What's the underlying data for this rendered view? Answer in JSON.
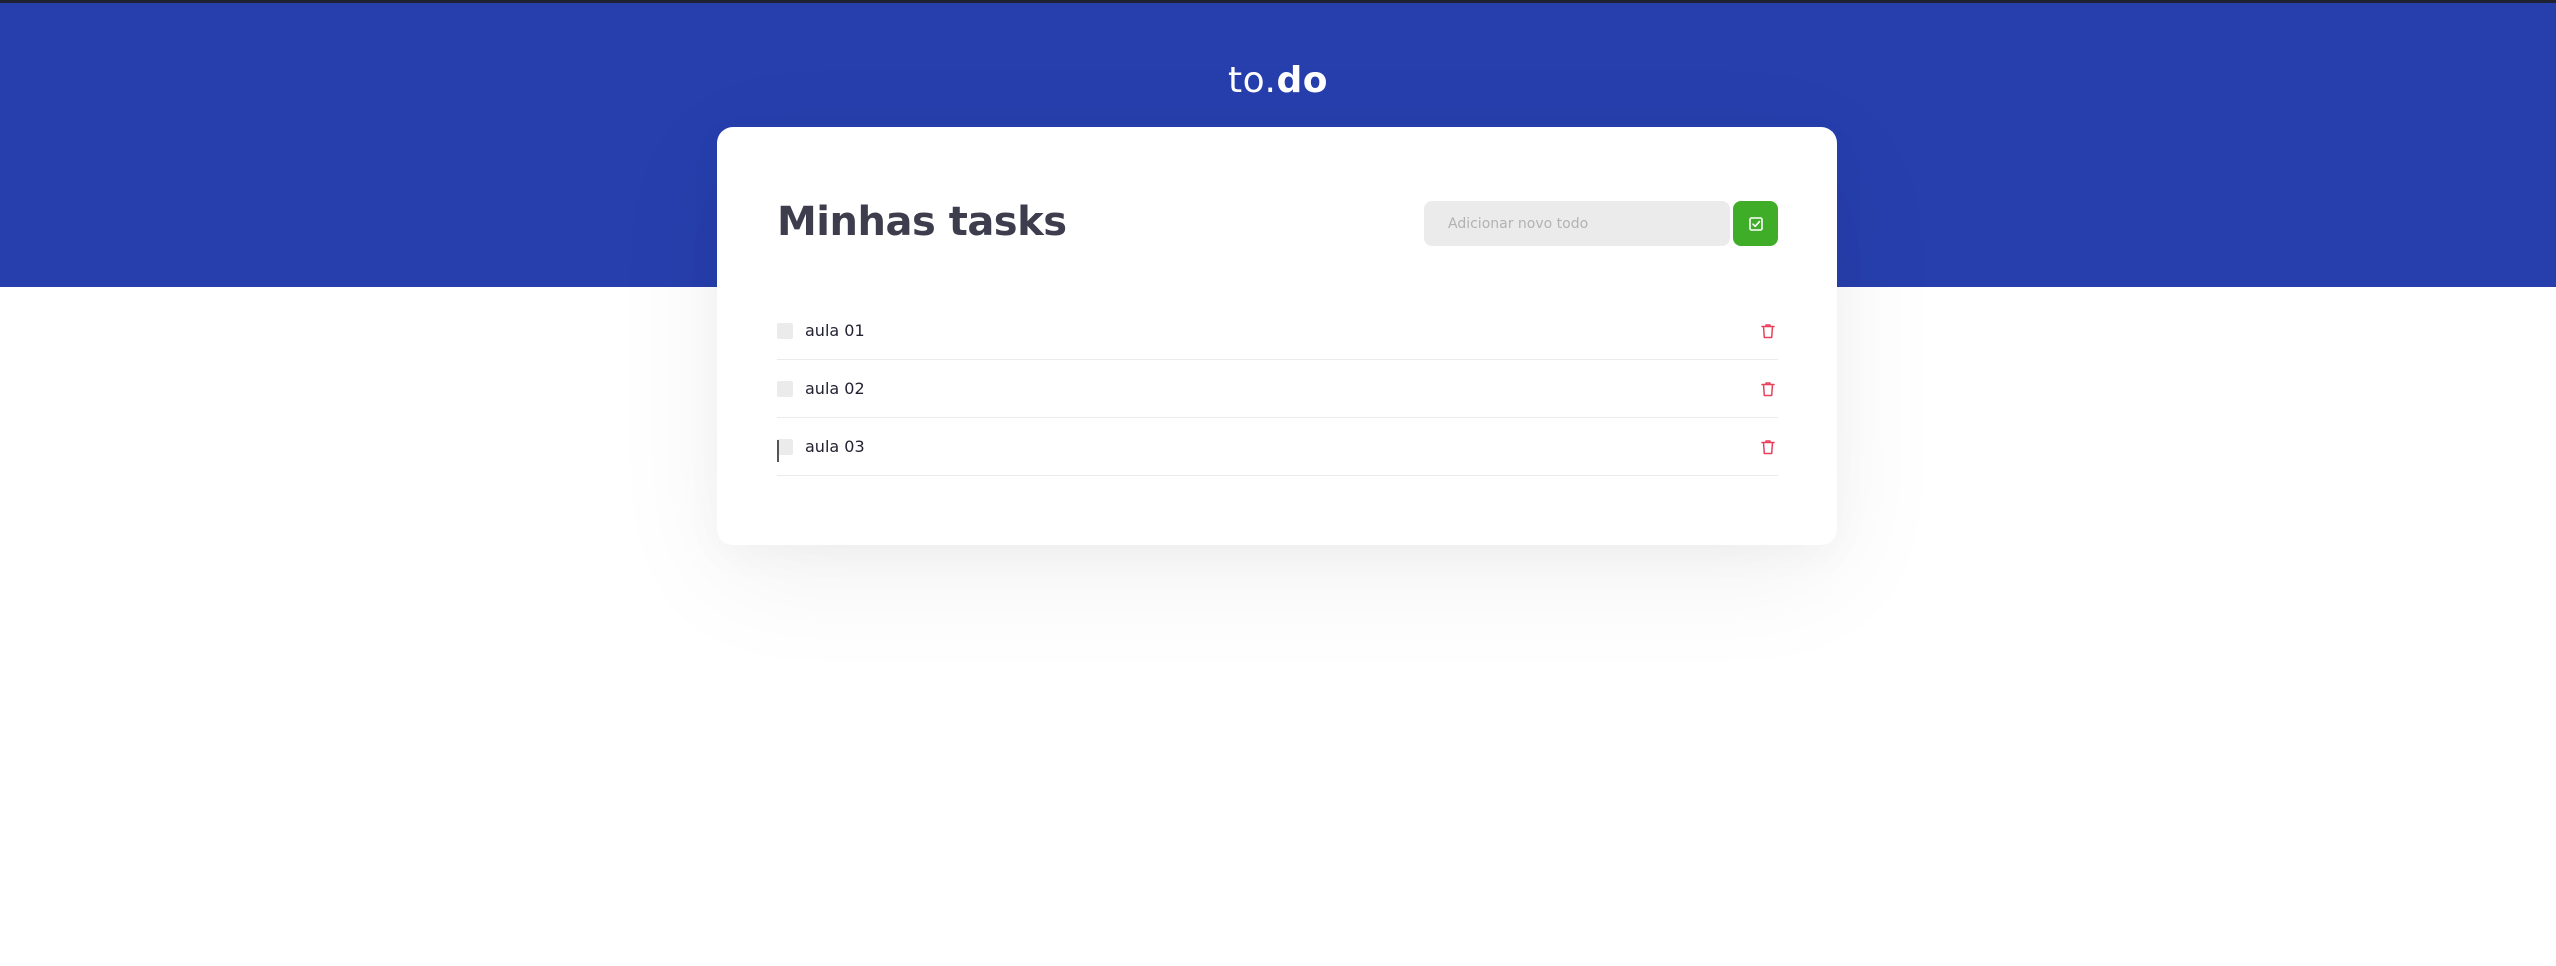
{
  "header": {
    "logo_light": "to.",
    "logo_bold": "do",
    "background_color": "#273fad"
  },
  "main": {
    "title": "Minhas tasks",
    "new_todo": {
      "placeholder": "Adicionar novo todo",
      "value": ""
    },
    "add_button": {
      "icon": "checkbox-add-icon",
      "color": "#3fad27"
    },
    "tasks": [
      {
        "label": "aula 01",
        "completed": false
      },
      {
        "label": "aula 02",
        "completed": false
      },
      {
        "label": "aula 03",
        "completed": false
      }
    ],
    "delete_icon": "trash-icon",
    "delete_color": "#e83f5b"
  }
}
